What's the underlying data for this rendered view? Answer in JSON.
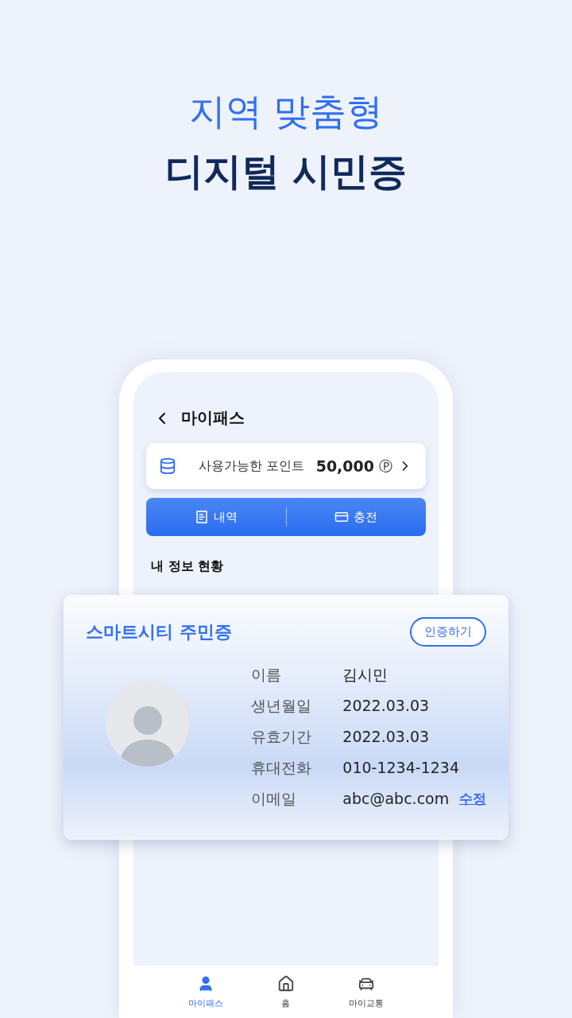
{
  "headline": {
    "subtitle": "지역 맞춤형",
    "title": "디지털 시민증"
  },
  "phone": {
    "header": {
      "title": "마이패스"
    },
    "points": {
      "label": "사용가능한 포인트",
      "amount": "50,000",
      "unit": "Ⓟ"
    },
    "actions": [
      {
        "label": "내역",
        "kind": "history"
      },
      {
        "label": "충전",
        "kind": "charge"
      }
    ],
    "section_title": "내 정보 현황",
    "nav": [
      {
        "label": "마이패스",
        "kind": "user",
        "selected": true
      },
      {
        "label": "홈",
        "kind": "home",
        "selected": false
      },
      {
        "label": "마이교통",
        "kind": "transport",
        "selected": false
      }
    ]
  },
  "id_card": {
    "title": "스마트시티 주민증",
    "verify_button": "인증하기",
    "fields": [
      {
        "label": "이름",
        "value": "김시민"
      },
      {
        "label": "생년월일",
        "value": "2022.03.03"
      },
      {
        "label": "유효기간",
        "value": "2022.03.03"
      },
      {
        "label": "휴대전화",
        "value": "010-1234-1234"
      },
      {
        "label": "이메일",
        "value": "abc@abc.com",
        "action": "수정"
      }
    ]
  }
}
